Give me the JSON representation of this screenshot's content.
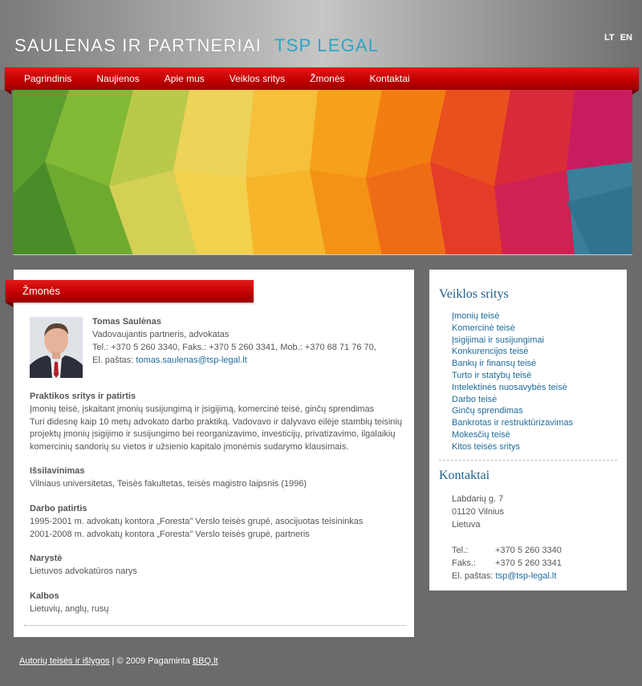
{
  "header": {
    "logo_main": "SAULENAS IR PARTNERIAI",
    "logo_brand": "TSP LEGAL",
    "lang_lt": "LT",
    "lang_en": "EN"
  },
  "nav": {
    "items": [
      "Pagrindinis",
      "Naujienos",
      "Apie mus",
      "Veiklos sritys",
      "Žmonės",
      "Kontaktai"
    ]
  },
  "main": {
    "heading": "Žmonės",
    "person": {
      "name": "Tomas Saulėnas",
      "role": "Vadovaujantis partneris, advokatas",
      "phones": "Tel.: +370 5 260 3340, Faks.: +370 5 260 3341, Mob.: +370 68 71 76 70,",
      "email_label": "El. paštas:",
      "email": "tomas.saulenas@tsp-legal.lt"
    },
    "sections": [
      {
        "title": "Praktikos sritys ir patirtis",
        "lines": [
          "Įmonių teisė, įskaitant įmonių susijungimą ir įsigijimą, komercinė teisė, ginčų sprendimas",
          "Turi didesnę kaip 10 metų advokato darbo praktiką. Vadovavo ir dalyvavo eilėje stambių teisinių",
          "projektų įmonių įsigijimo ir susijungimo bei reorganizavimo, investicijų, privatizavimo, ilgalaikių",
          "komercinių sandorių su vietos ir užsienio kapitalo įmonėmis sudarymo klausimais."
        ]
      },
      {
        "title": "Išsilavinimas",
        "lines": [
          "Vilniaus universitetas, Teisės fakultetas, teisės magistro laipsnis (1996)"
        ]
      },
      {
        "title": "Darbo patirtis",
        "lines": [
          "1995-2001 m. advokatų kontora „Foresta\" Verslo teisės grupė, asocijuotas teisininkas",
          "2001-2008 m. advokatų kontora „Foresta\" Verslo teisės grupė, partneris"
        ]
      },
      {
        "title": "Narystė",
        "lines": [
          "Lietuvos advokatūros narys"
        ]
      },
      {
        "title": "Kalbos",
        "lines": [
          "Lietuvių, anglų, rusų"
        ]
      }
    ]
  },
  "sidebar": {
    "areas_title": "Veiklos sritys",
    "areas": [
      "Įmonių teisė",
      "Komercinė teisė",
      "Įsigijimai ir susijungimai",
      "Konkurencijos teisė",
      "Bankų ir finansų teisė",
      "Turto ir statybų teisė",
      "Intelektinės nuosavybės teisė",
      "Darbo teisė",
      "Ginčų sprendimas",
      "Bankrotas ir restruktūrizavimas",
      "Mokesčių teisė",
      "Kitos teisės sritys"
    ],
    "contacts_title": "Kontaktai",
    "address": [
      "Labdarių g. 7",
      "01120 Vilnius",
      "Lietuva"
    ],
    "tel_label": "Tel.:",
    "tel": "+370 5 260 3340",
    "fax_label": "Faks.:",
    "fax": "+370 5 260 3341",
    "email_label": "El. paštas:",
    "email": "tsp@tsp-legal.lt"
  },
  "footer": {
    "terms_link": "Autorių teisės ir išlygos",
    "copyright": " | © 2009 Pagaminta ",
    "maker_link": "BBQ.lt"
  },
  "colors": {
    "accent_red": "#c30000",
    "link_blue": "#1f6b9a",
    "brand_teal": "#2aa6c4",
    "background": "#6b6b6b"
  }
}
